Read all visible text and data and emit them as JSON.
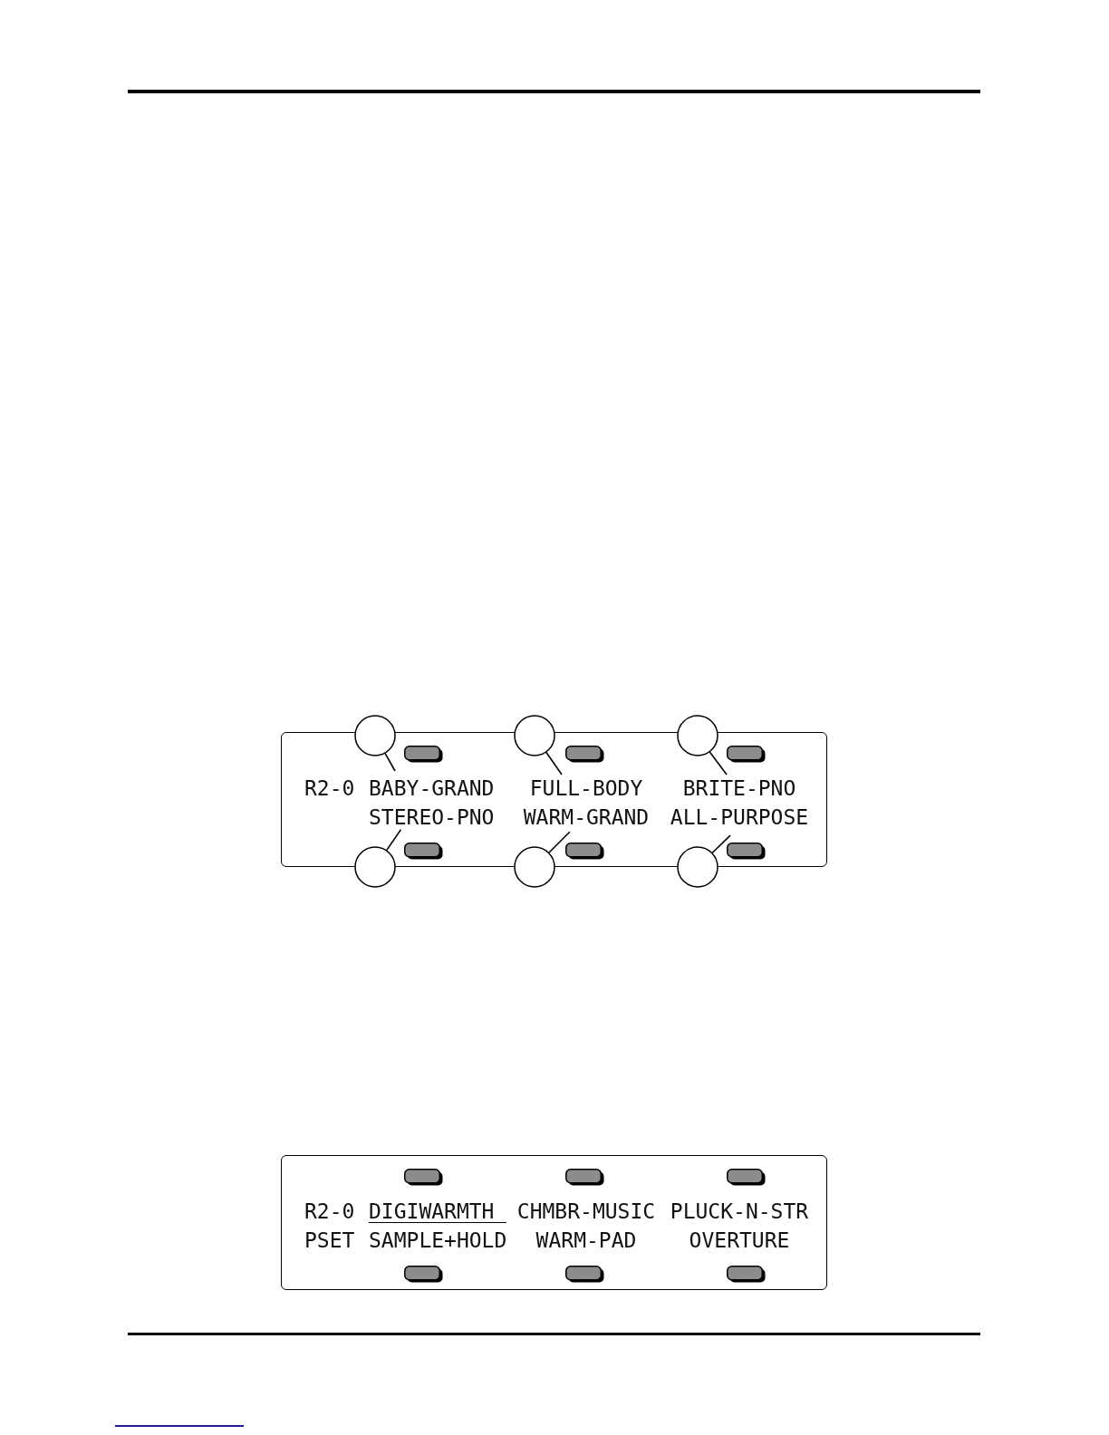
{
  "displays": [
    {
      "callouts": true,
      "lines": [
        {
          "label": "R2-0",
          "slots": [
            {
              "text": "BABY-GRAND",
              "cursor": false
            },
            {
              "text": "FULL-BODY",
              "cursor": false
            },
            {
              "text": "BRITE-PNO",
              "cursor": false
            }
          ]
        },
        {
          "slots": [
            {
              "text": "STEREO-PNO",
              "cursor": false
            },
            {
              "text": "WARM-GRAND",
              "cursor": false
            },
            {
              "text": "ALL-PURPOSE",
              "cursor": false
            }
          ]
        }
      ]
    },
    {
      "callouts": false,
      "lines": [
        {
          "label": "R2-0",
          "slots": [
            {
              "text": "DIGIWARMTH",
              "cursor": true
            },
            {
              "text": "CHMBR-MUSIC",
              "cursor": false
            },
            {
              "text": "PLUCK-N-STR",
              "cursor": false
            }
          ]
        },
        {
          "label": "PSET",
          "slots": [
            {
              "text": "SAMPLE+HOLD",
              "cursor": false
            },
            {
              "text": "WARM-PAD",
              "cursor": false
            },
            {
              "text": "OVERTURE",
              "cursor": false
            }
          ]
        }
      ]
    }
  ]
}
